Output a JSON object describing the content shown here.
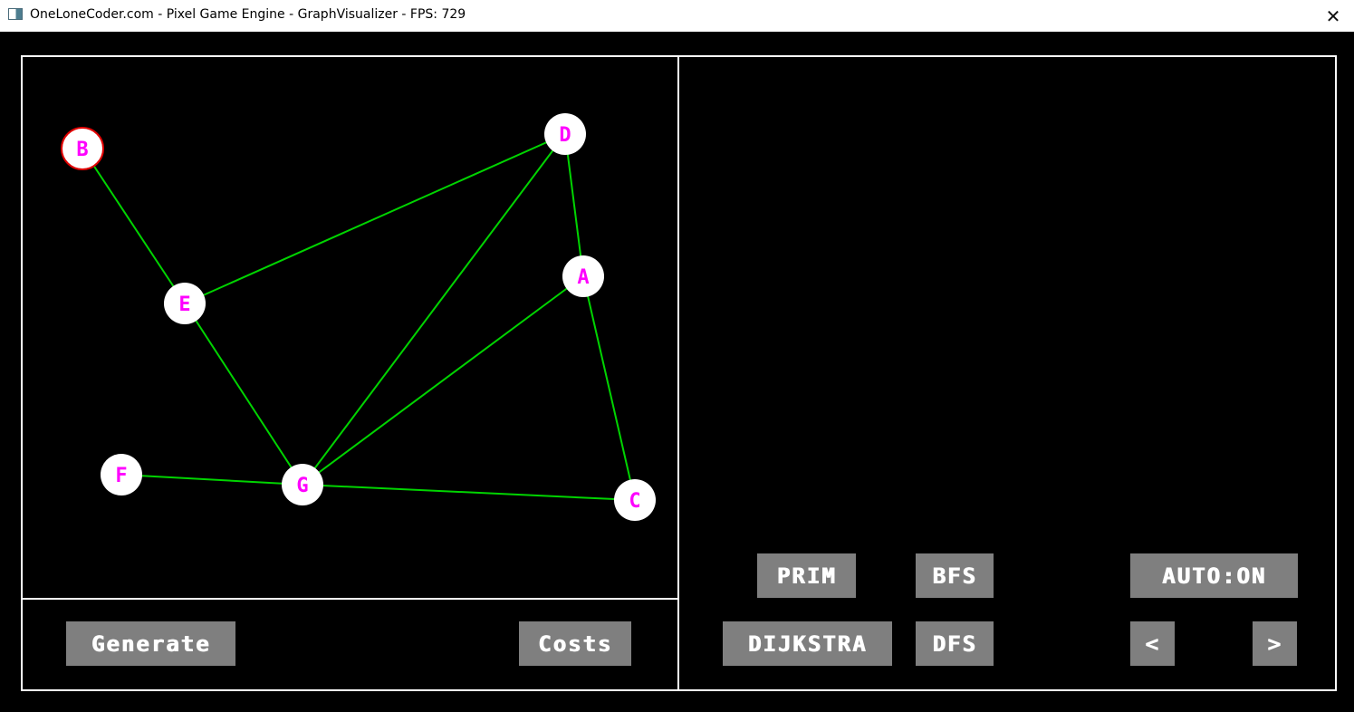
{
  "window": {
    "title": "OneLoneCoder.com - Pixel Game Engine - GraphVisualizer - FPS: 729",
    "close_glyph": "✕"
  },
  "colors": {
    "edge": "#00d400",
    "node_fill": "#ffffff",
    "node_label": "#ff00ff",
    "selected_ring": "#e00000",
    "button_bg": "#7f7f7f",
    "panel_border": "#ffffff"
  },
  "graph": {
    "nodes": [
      {
        "id": "B",
        "label": "B",
        "selected": true
      },
      {
        "id": "D",
        "label": "D",
        "selected": false
      },
      {
        "id": "A",
        "label": "A",
        "selected": false
      },
      {
        "id": "E",
        "label": "E",
        "selected": false
      },
      {
        "id": "F",
        "label": "F",
        "selected": false
      },
      {
        "id": "G",
        "label": "G",
        "selected": false
      },
      {
        "id": "C",
        "label": "C",
        "selected": false
      }
    ],
    "edges": [
      [
        "B",
        "E"
      ],
      [
        "E",
        "D"
      ],
      [
        "E",
        "G"
      ],
      [
        "D",
        "A"
      ],
      [
        "D",
        "G"
      ],
      [
        "A",
        "G"
      ],
      [
        "A",
        "C"
      ],
      [
        "F",
        "G"
      ],
      [
        "G",
        "C"
      ]
    ]
  },
  "buttons": {
    "generate": "Generate",
    "costs": "Costs",
    "prim": "PRIM",
    "bfs": "BFS",
    "dijkstra": "DIJKSTRA",
    "dfs": "DFS",
    "auto": "AUTO:ON",
    "prev": "<",
    "next": ">"
  }
}
